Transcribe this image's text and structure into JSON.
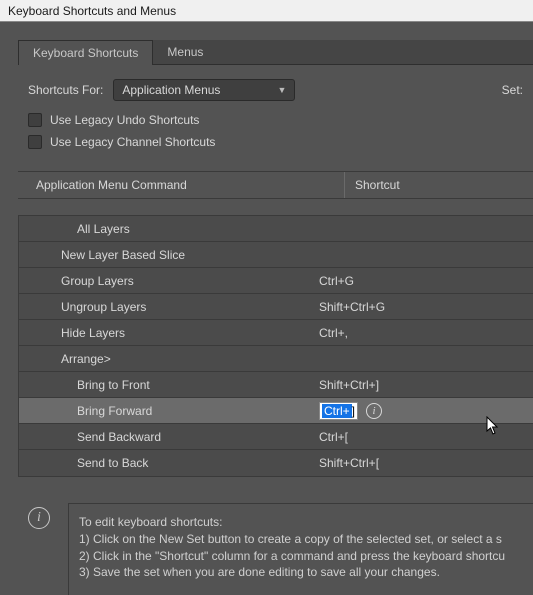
{
  "window": {
    "title": "Keyboard Shortcuts and Menus"
  },
  "tabs": {
    "shortcuts": "Keyboard Shortcuts",
    "menus": "Menus"
  },
  "controls": {
    "shortcuts_for_label": "Shortcuts For:",
    "shortcuts_for_value": "Application Menus",
    "set_label": "Set:"
  },
  "checkboxes": {
    "legacy_undo": "Use Legacy Undo Shortcuts",
    "legacy_channel": "Use Legacy Channel Shortcuts"
  },
  "table": {
    "header_cmd": "Application Menu Command",
    "header_sc": "Shortcut",
    "rows": [
      {
        "label": "All Layers",
        "shortcut": "",
        "depth": 1,
        "selected": false
      },
      {
        "label": "New Layer Based Slice",
        "shortcut": "",
        "depth": 0,
        "selected": false
      },
      {
        "label": "Group Layers",
        "shortcut": "Ctrl+G",
        "depth": 0,
        "selected": false
      },
      {
        "label": "Ungroup Layers",
        "shortcut": "Shift+Ctrl+G",
        "depth": 0,
        "selected": false
      },
      {
        "label": "Hide Layers",
        "shortcut": "Ctrl+,",
        "depth": 0,
        "selected": false
      },
      {
        "label": "Arrange>",
        "shortcut": "",
        "depth": 0,
        "selected": false
      },
      {
        "label": "Bring to Front",
        "shortcut": "Shift+Ctrl+]",
        "depth": 1,
        "selected": false
      },
      {
        "label": "Bring Forward",
        "shortcut": "Ctrl+]",
        "depth": 1,
        "selected": true
      },
      {
        "label": "Send Backward",
        "shortcut": "Ctrl+[",
        "depth": 1,
        "selected": false
      },
      {
        "label": "Send to Back",
        "shortcut": "Shift+Ctrl+[",
        "depth": 1,
        "selected": false
      }
    ]
  },
  "help": {
    "line0": "To edit keyboard shortcuts:",
    "line1": "1) Click on the New Set button to create a copy of the selected set, or select a s",
    "line2": "2) Click in the \"Shortcut\" column for a command and press the keyboard shortcu",
    "line3": "3) Save the set when you are done editing to save all your changes."
  }
}
